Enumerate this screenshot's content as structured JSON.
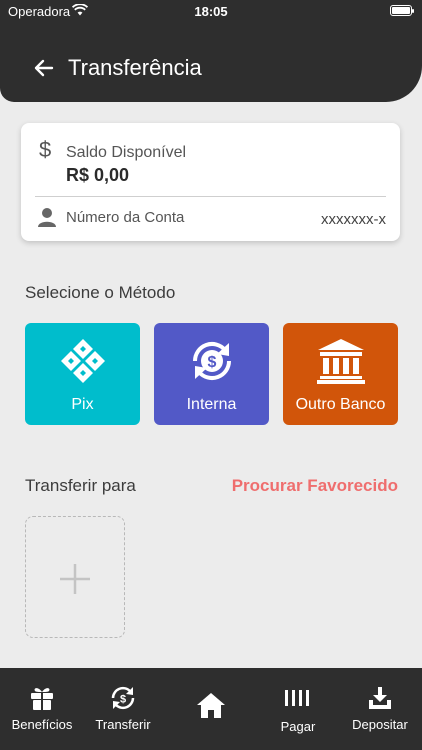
{
  "status_bar": {
    "carrier": "Operadora",
    "time": "18:05"
  },
  "header": {
    "title": "Transferência"
  },
  "balance_card": {
    "balance_label": "Saldo Disponível",
    "balance_value": "R$ 0,00",
    "account_label": "Número da Conta",
    "account_value": "xxxxxxx-x"
  },
  "methods": {
    "title": "Selecione o Método",
    "items": [
      {
        "label": "Pix",
        "icon": "pix-icon",
        "color": "#00bdcc"
      },
      {
        "label": "Interna",
        "icon": "exchange-icon",
        "color": "#5259c7"
      },
      {
        "label": "Outro Banco",
        "icon": "bank-icon",
        "color": "#d1550a"
      }
    ]
  },
  "transfer": {
    "title": "Transferir para",
    "search_label": "Procurar Favorecido"
  },
  "bottom_nav": {
    "items": [
      {
        "label": "Benefícios",
        "icon": "gift-icon"
      },
      {
        "label": "Transferir",
        "icon": "transfer-icon"
      },
      {
        "label": "",
        "icon": "home-icon"
      },
      {
        "label": "Pagar",
        "icon": "barcode-icon"
      },
      {
        "label": "Depositar",
        "icon": "download-icon"
      }
    ]
  }
}
